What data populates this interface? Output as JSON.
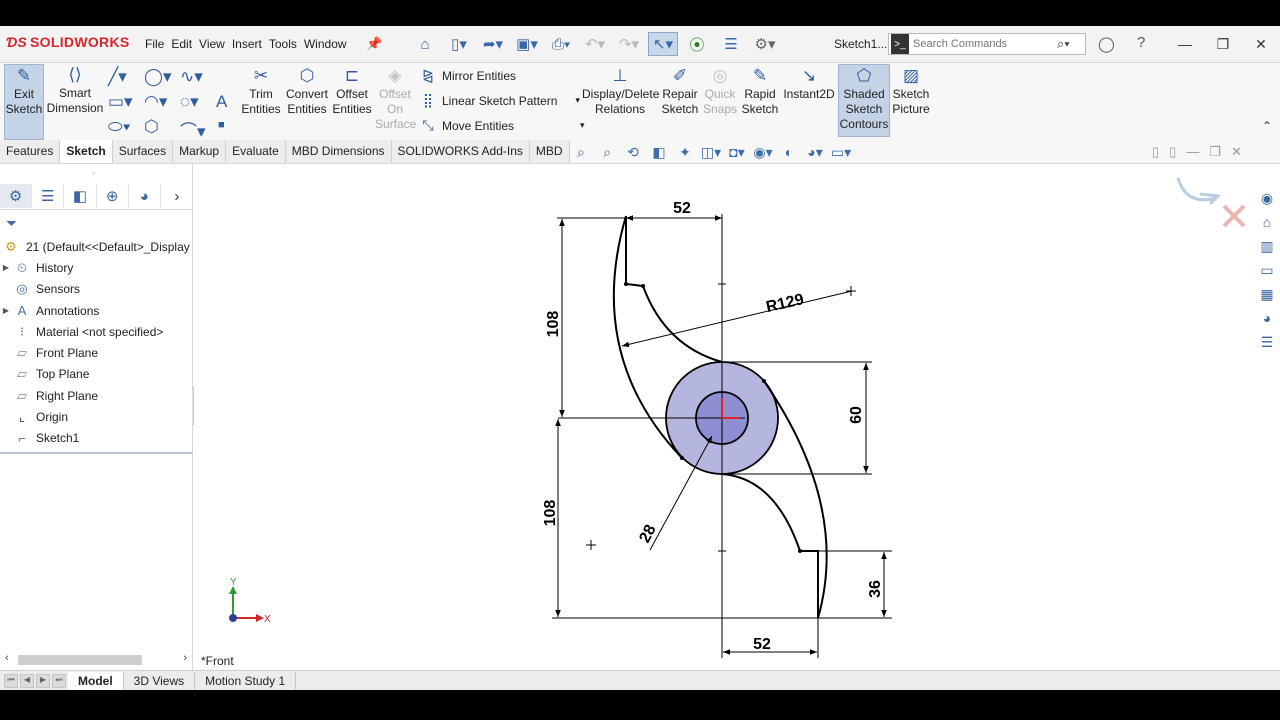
{
  "app": {
    "logo": "SOLIDWORKS",
    "menus": [
      "File",
      "Edit",
      "View",
      "Insert",
      "Tools",
      "Window"
    ],
    "doc_title": "Sketch1...",
    "search_placeholder": "Search Commands"
  },
  "ribbon": {
    "exit_sketch": "Exit\nSketch",
    "smart_dimension": "Smart\nDimension",
    "trim_entities": "Trim\nEntities",
    "convert_entities": "Convert\nEntities",
    "offset_entities": "Offset\nEntities",
    "offset_on_surface": "Offset\nOn\nSurface",
    "mirror_entities": "Mirror Entities",
    "linear_sketch_pattern": "Linear Sketch Pattern",
    "move_entities": "Move Entities",
    "display_delete_relations": "Display/Delete\nRelations",
    "repair_sketch": "Repair\nSketch",
    "quick_snaps": "Quick\nSnaps",
    "rapid_sketch": "Rapid\nSketch",
    "instant2d": "Instant2D",
    "shaded_sketch_contours": "Shaded\nSketch\nContours",
    "sketch_picture": "Sketch\nPicture"
  },
  "tabs": [
    {
      "label": "Features",
      "active": false
    },
    {
      "label": "Sketch",
      "active": true
    },
    {
      "label": "Surfaces",
      "active": false
    },
    {
      "label": "Markup",
      "active": false
    },
    {
      "label": "Evaluate",
      "active": false
    },
    {
      "label": "MBD Dimensions",
      "active": false
    },
    {
      "label": "SOLIDWORKS Add-Ins",
      "active": false
    },
    {
      "label": "MBD",
      "active": false
    }
  ],
  "tree": {
    "root": "21  (Default<<Default>_Display",
    "items": [
      {
        "label": "History",
        "icon": "history-icon",
        "expandable": true
      },
      {
        "label": "Sensors",
        "icon": "sensors-icon",
        "expandable": false
      },
      {
        "label": "Annotations",
        "icon": "annotations-icon",
        "expandable": true
      },
      {
        "label": "Material <not specified>",
        "icon": "material-icon",
        "expandable": false
      },
      {
        "label": "Front Plane",
        "icon": "plane-icon",
        "expandable": false
      },
      {
        "label": "Top Plane",
        "icon": "plane-icon",
        "expandable": false
      },
      {
        "label": "Right Plane",
        "icon": "plane-icon",
        "expandable": false
      },
      {
        "label": "Origin",
        "icon": "origin-icon",
        "expandable": false
      },
      {
        "label": "Sketch1",
        "icon": "sketch-icon",
        "expandable": false
      }
    ]
  },
  "sketch": {
    "dims": {
      "top_width": "52",
      "bottom_width": "52",
      "upper_height": "108",
      "lower_height": "108",
      "radius": "R129",
      "circle_dia": "60",
      "hole_dia": "28",
      "step_height": "36"
    },
    "colors": {
      "fill": "#b5b6e0",
      "inner_fill": "#8e8fd2",
      "stroke": "#000000",
      "origin": "#e0242b"
    }
  },
  "view_name": "*Front",
  "triad": {
    "x": "X",
    "y": "Y"
  },
  "bottom_tabs": [
    {
      "label": "Model",
      "active": true
    },
    {
      "label": "3D Views",
      "active": false
    },
    {
      "label": "Motion Study 1",
      "active": false
    }
  ]
}
